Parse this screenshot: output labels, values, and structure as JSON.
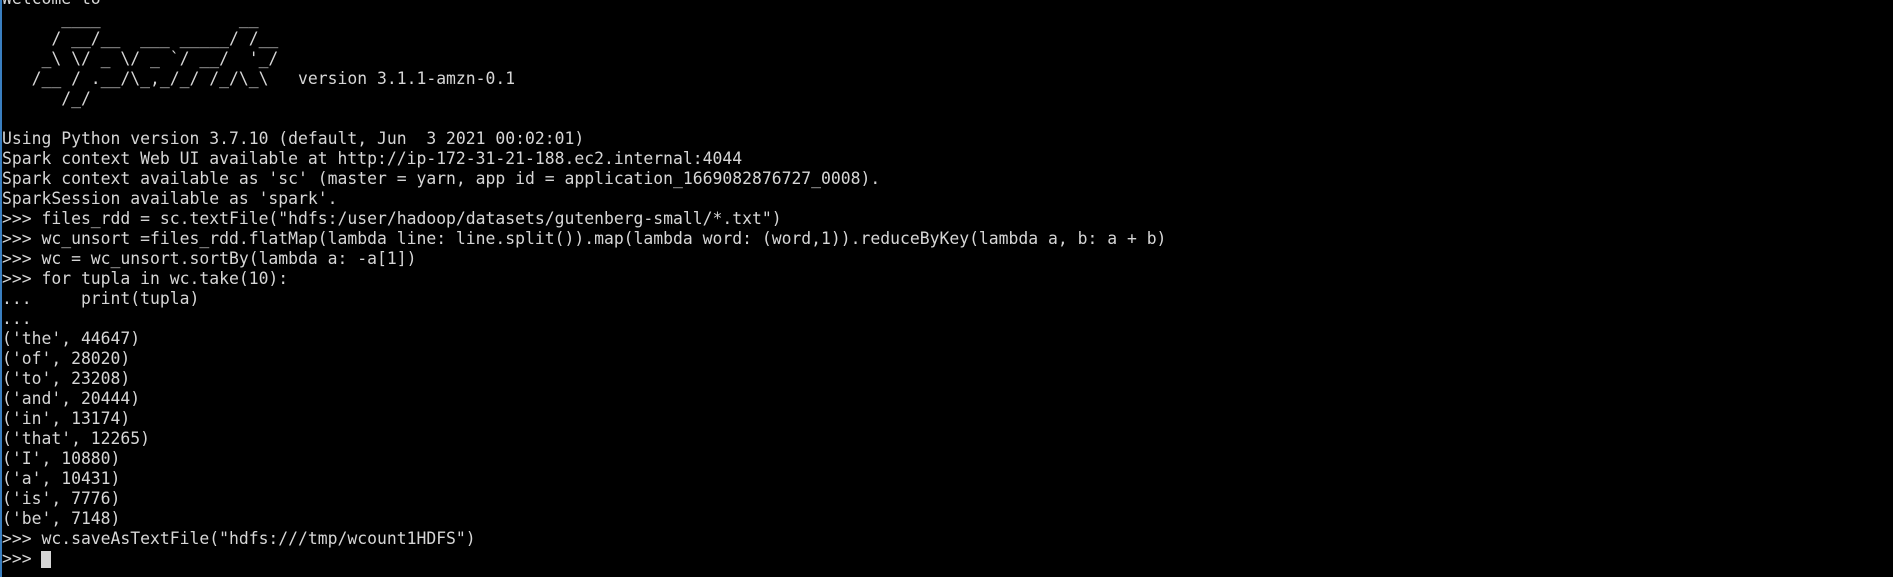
{
  "terminal": {
    "lines": [
      "Welcome to",
      "      ____              __",
      "     / __/__  ___ _____/ /__",
      "    _\\ \\/ _ \\/ _ `/ __/  '_/",
      "   /__ / .__/\\_,_/_/ /_/\\_\\   version 3.1.1-amzn-0.1",
      "      /_/",
      "",
      "Using Python version 3.7.10 (default, Jun  3 2021 00:02:01)",
      "Spark context Web UI available at http://ip-172-31-21-188.ec2.internal:4044",
      "Spark context available as 'sc' (master = yarn, app id = application_1669082876727_0008).",
      "SparkSession available as 'spark'.",
      ">>> files_rdd = sc.textFile(\"hdfs:/user/hadoop/datasets/gutenberg-small/*.txt\")",
      ">>> wc_unsort =files_rdd.flatMap(lambda line: line.split()).map(lambda word: (word,1)).reduceByKey(lambda a, b: a + b)",
      ">>> wc = wc_unsort.sortBy(lambda a: -a[1])",
      ">>> for tupla in wc.take(10):",
      "...     print(tupla)",
      "...",
      "('the', 44647)",
      "('of', 28020)",
      "('to', 23208)",
      "('and', 20444)",
      "('in', 13174)",
      "('that', 12265)",
      "('I', 10880)",
      "('a', 10431)",
      "('is', 7776)",
      "('be', 7148)",
      ">>> wc.saveAsTextFile(\"hdfs:///tmp/wcount1HDFS\")"
    ],
    "prompt": ">>> ",
    "colors": {
      "background": "#000000",
      "foreground": "#d6d6d6",
      "edge": "#3a7fc0"
    }
  }
}
